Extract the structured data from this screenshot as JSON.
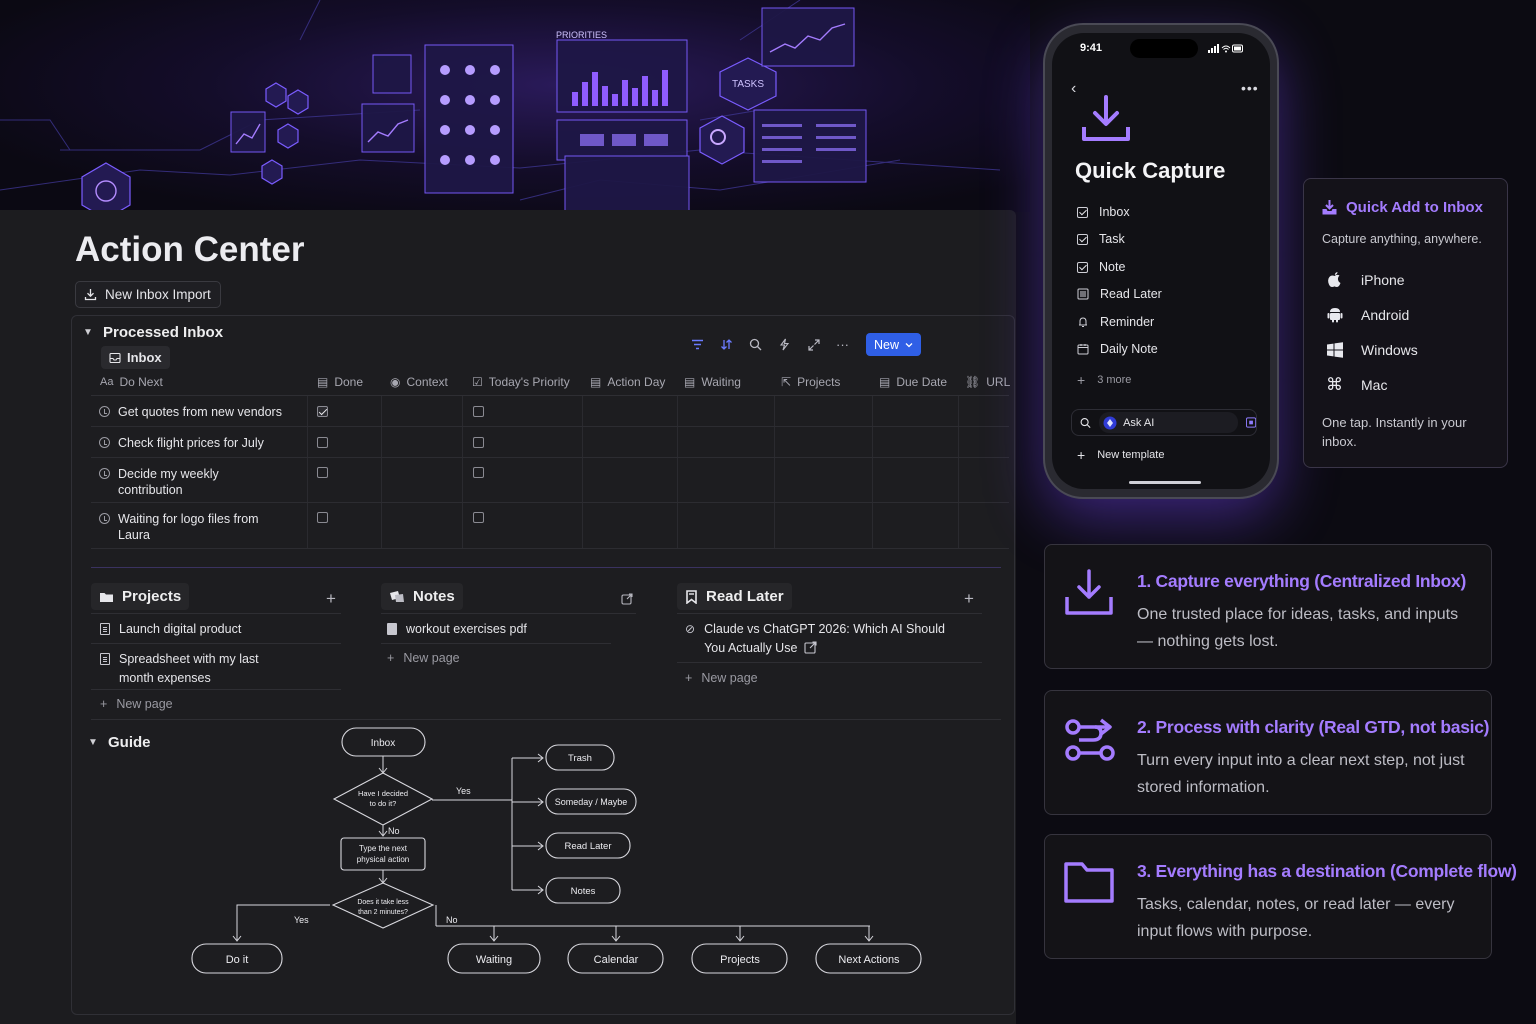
{
  "hero": {
    "label_priorities": "PRIORITIES",
    "label_tasks": "TASKS"
  },
  "page": {
    "title": "Action Center",
    "import_button": "New Inbox Import"
  },
  "processed_inbox": {
    "title": "Processed Inbox",
    "view_tab": "Inbox",
    "new_button": "New",
    "columns": [
      "Do Next",
      "Done",
      "Context",
      "Today's Priority",
      "Action Day",
      "Waiting",
      "Projects",
      "Due Date",
      "URL"
    ],
    "rows": [
      {
        "title": "Get quotes from new vendors",
        "done": true,
        "priority": false
      },
      {
        "title": "Check flight prices for July",
        "done": false,
        "priority": false
      },
      {
        "title": "Decide my weekly contribution",
        "done": false,
        "priority": false
      },
      {
        "title": "Waiting for logo files from Laura",
        "done": false,
        "priority": false
      }
    ]
  },
  "projects": {
    "title": "Projects",
    "items": [
      "Launch digital product",
      "Spreadsheet with my last month expenses"
    ],
    "new_page": "New page"
  },
  "notes": {
    "title": "Notes",
    "items": [
      "workout exercises pdf"
    ],
    "new_page": "New page"
  },
  "read_later": {
    "title": "Read Later",
    "items": [
      "Claude vs ChatGPT 2026: Which AI Should You Actually Use"
    ],
    "new_page": "New page"
  },
  "guide": {
    "title": "Guide",
    "flow": {
      "inbox": "Inbox",
      "decision1": [
        "Have I decided",
        "to do it?"
      ],
      "yes1": "Yes",
      "no1": "No",
      "action": [
        "Type the next",
        "physical action"
      ],
      "decision2": [
        "Does it take less",
        "than 2 minutes?"
      ],
      "yes2": "Yes",
      "no2": "No",
      "trash": "Trash",
      "someday": "Someday / Maybe",
      "read_later": "Read Later",
      "notes": "Notes",
      "do_it": "Do it",
      "waiting": "Waiting",
      "calendar": "Calendar",
      "projects": "Projects",
      "next_actions": "Next Actions"
    }
  },
  "phone": {
    "time": "9:41",
    "title": "Quick Capture",
    "items": [
      {
        "label": "Inbox",
        "icon": "checkbox-icon"
      },
      {
        "label": "Task",
        "icon": "checkbox-icon"
      },
      {
        "label": "Note",
        "icon": "checkbox-icon"
      },
      {
        "label": "Read Later",
        "icon": "list-icon"
      },
      {
        "label": "Reminder",
        "icon": "bell-icon"
      },
      {
        "label": "Daily Note",
        "icon": "calendar-icon"
      }
    ],
    "more": "3 more",
    "ask_ai": "Ask AI",
    "new_template": "New template"
  },
  "quick_add": {
    "title": "Quick Add to Inbox",
    "subtitle": "Capture anything, anywhere.",
    "platforms": [
      "iPhone",
      "Android",
      "Windows",
      "Mac"
    ],
    "footer": "One tap. Instantly in your inbox."
  },
  "features": [
    {
      "title": "1. Capture everything (Centralized Inbox)",
      "desc": "One trusted place for ideas, tasks, and inputs — nothing gets lost."
    },
    {
      "title": "2. Process with clarity (Real GTD, not basic)",
      "desc": "Turn every input into a clear next step, not just stored information."
    },
    {
      "title": "3. Everything has a destination (Complete flow)",
      "desc": "Tasks, calendar, notes, or read later — every input flows with purpose."
    }
  ],
  "colors": {
    "accent": "#a47cff",
    "button_blue": "#2f5fe6",
    "panel": "#1c1c1f",
    "background": "#0c0b12"
  }
}
